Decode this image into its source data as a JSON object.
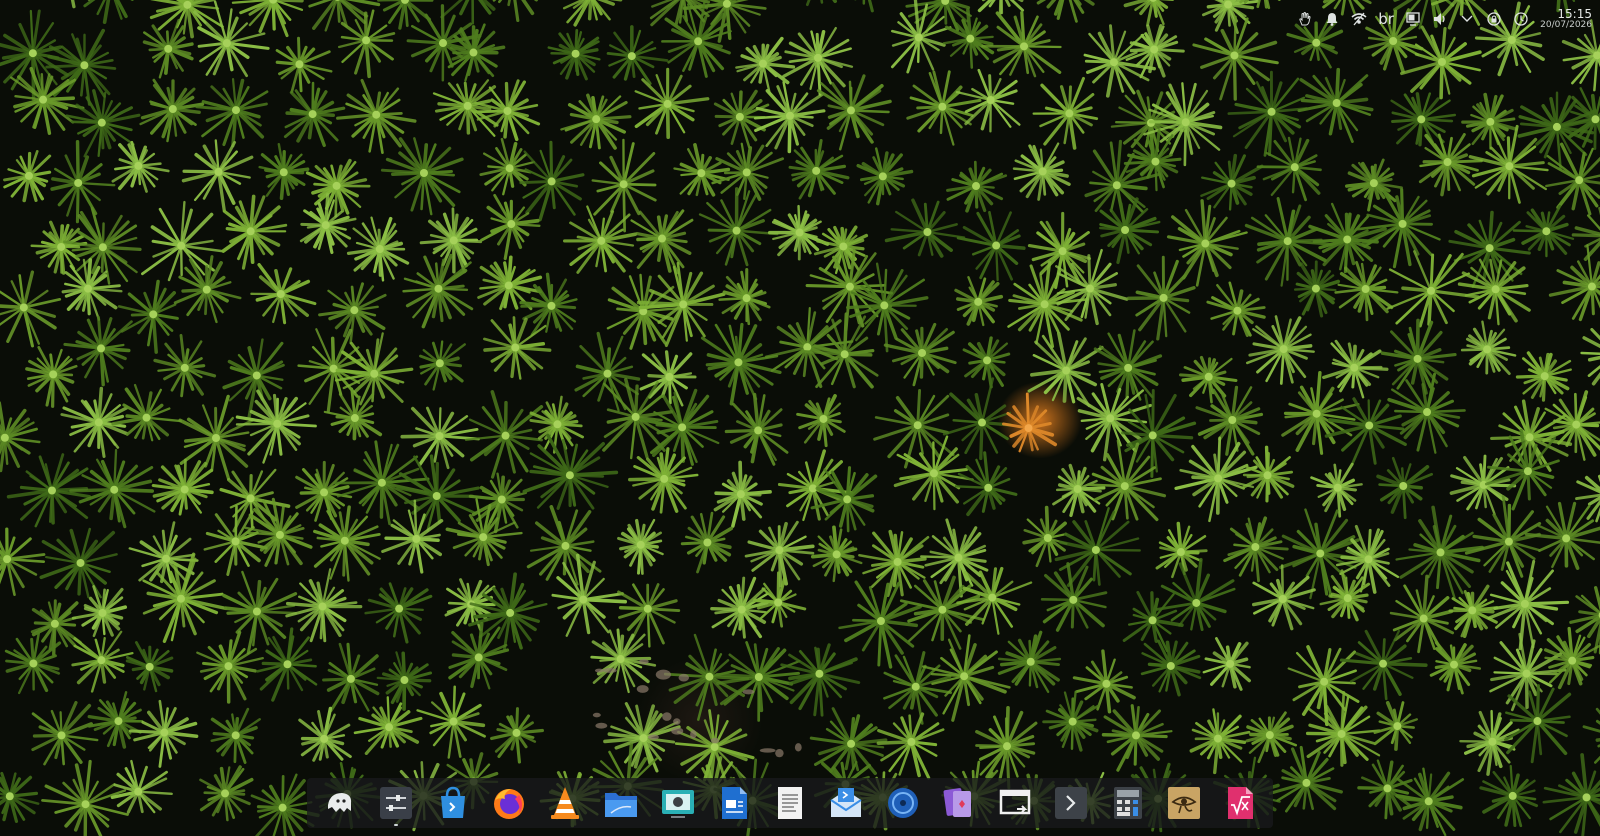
{
  "desktop": {
    "wallpaper": "moss-wallpaper",
    "colors": {
      "moss": "#6a9a2a",
      "accent_flower": "#d8782a",
      "dock_bg": "#181a1c"
    }
  },
  "tray": {
    "keyboard_layout": "br",
    "time": "15:15",
    "date": "20/07/2026",
    "icons": [
      "hand-icon",
      "notification-bell-icon",
      "network-icon",
      "keyboard-layout",
      "display-icon",
      "volume-icon",
      "expand-tray-icon",
      "vpn-icon",
      "power-icon"
    ]
  },
  "dock": {
    "apps": [
      {
        "name": "ghost-app",
        "icon": "ghost-icon"
      },
      {
        "name": "system-settings",
        "icon": "settings-sliders-icon"
      },
      {
        "name": "app-store",
        "icon": "shopping-bag-icon"
      },
      {
        "name": "firefox",
        "icon": "firefox-icon"
      },
      {
        "name": "vlc",
        "icon": "vlc-cone-icon"
      },
      {
        "name": "file-manager",
        "icon": "folder-icon"
      },
      {
        "name": "screenshot",
        "icon": "camera-icon"
      },
      {
        "name": "writer",
        "icon": "document-writer-icon"
      },
      {
        "name": "text-editor",
        "icon": "text-document-icon"
      },
      {
        "name": "mail",
        "icon": "mail-icon"
      },
      {
        "name": "disk-utility",
        "icon": "disk-icon"
      },
      {
        "name": "card-game",
        "icon": "cards-icon"
      },
      {
        "name": "window-switcher",
        "icon": "window-switch-icon"
      },
      {
        "name": "terminal",
        "icon": "terminal-icon"
      },
      {
        "name": "calculator",
        "icon": "calculator-icon"
      },
      {
        "name": "eye-app",
        "icon": "eye-of-horus-icon"
      },
      {
        "name": "math-formula",
        "icon": "formula-icon"
      }
    ]
  }
}
